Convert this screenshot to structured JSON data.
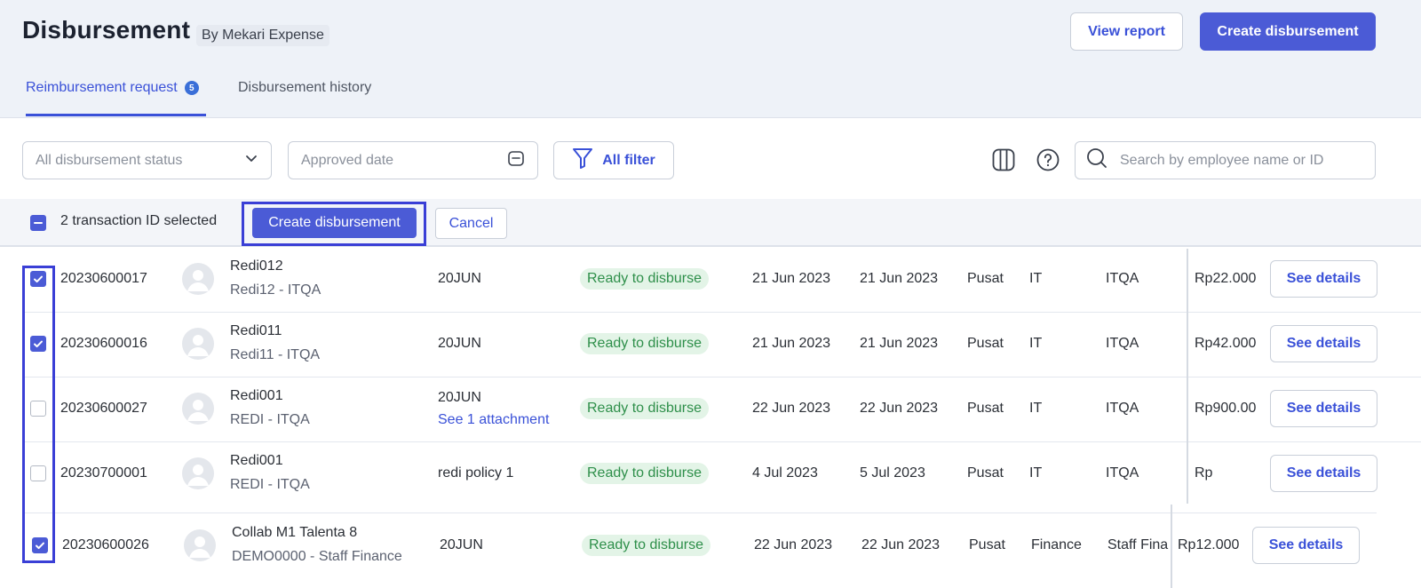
{
  "header": {
    "title": "Disbursement",
    "subtitle": "By Mekari Expense",
    "view_report_label": "View report",
    "create_label": "Create disbursement"
  },
  "tabs": [
    {
      "label": "Reimbursement request",
      "badge": "5",
      "active": true
    },
    {
      "label": "Disbursement history",
      "active": false
    }
  ],
  "filters": {
    "status_value": "All disbursement status",
    "date_placeholder": "Approved date",
    "all_filter_label": "All filter",
    "search_placeholder": "Search by employee name or ID"
  },
  "selection": {
    "text": "2 transaction ID selected",
    "create_label": "Create disbursement",
    "cancel_label": "Cancel"
  },
  "rows": [
    {
      "id": "20230600017",
      "name": "Redi012",
      "subname": "Redi12 - ITQA",
      "desc": "20JUN",
      "attachment": "",
      "status": "Ready to disburse",
      "date1": "21 Jun 2023",
      "date2": "21 Jun 2023",
      "branch": "Pusat",
      "dept": "IT",
      "team": "ITQA",
      "amount": "Rp22.000",
      "details_label": "See details",
      "checked": true
    },
    {
      "id": "20230600016",
      "name": "Redi011",
      "subname": "Redi11 - ITQA",
      "desc": "20JUN",
      "attachment": "",
      "status": "Ready to disburse",
      "date1": "21 Jun 2023",
      "date2": "21 Jun 2023",
      "branch": "Pusat",
      "dept": "IT",
      "team": "ITQA",
      "amount": "Rp42.000",
      "details_label": "See details",
      "checked": true
    },
    {
      "id": "20230600027",
      "name": "Redi001",
      "subname": "REDI - ITQA",
      "desc": "20JUN",
      "attachment": "See 1 attachment",
      "status": "Ready to disburse",
      "date1": "22 Jun 2023",
      "date2": "22 Jun 2023",
      "branch": "Pusat",
      "dept": "IT",
      "team": "ITQA",
      "amount": "Rp900.00",
      "details_label": "See details",
      "checked": false
    },
    {
      "id": "20230700001",
      "name": "Redi001",
      "subname": "REDI - ITQA",
      "desc": "redi policy 1",
      "attachment": "",
      "status": "Ready to disburse",
      "date1": "4 Jul 2023",
      "date2": "5 Jul 2023",
      "branch": "Pusat",
      "dept": "IT",
      "team": "ITQA",
      "amount": "Rp",
      "details_label": "See details",
      "checked": false
    },
    {
      "id": "20230600026",
      "name": "Collab M1 Talenta 8",
      "subname": "DEMO0000 - Staff Finance",
      "desc": "20JUN",
      "attachment": "",
      "status": "Ready to disburse",
      "date1": "22 Jun 2023",
      "date2": "22 Jun 2023",
      "branch": "Pusat",
      "dept": "Finance",
      "team": "Staff Fina",
      "amount": "Rp12.000",
      "details_label": "See details",
      "checked": true
    }
  ],
  "colors": {
    "accent": "#4b5bd6",
    "highlight": "#3a3fd6",
    "status_bg": "#e3f4e7",
    "status_text": "#2e8f4a"
  }
}
